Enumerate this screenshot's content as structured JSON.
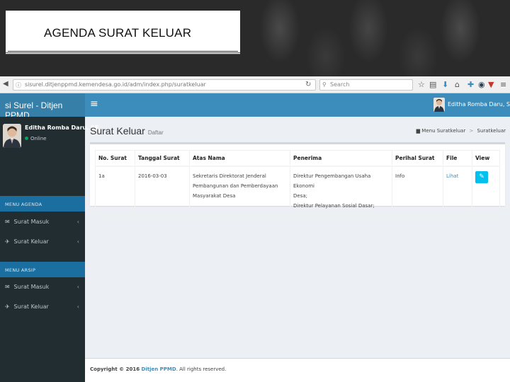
{
  "slide": {
    "title": "AGENDA SURAT KELUAR"
  },
  "browser": {
    "url": "sisurel.ditjenppmd.kemendesa.go.id/adm/index.php/suratkeluar",
    "search_placeholder": "Search"
  },
  "app": {
    "logo": "si Surel - Ditjen PPMD",
    "hamburger": "≡",
    "header_user_name": "Editha Romba Daru, SE"
  },
  "sidebar": {
    "user_name": "Editha Romba Daru, SE",
    "user_status": "Online",
    "sections": [
      {
        "header": "MENU AGENDA",
        "items": [
          {
            "label": "Surat Masuk",
            "icon": "envelope-icon"
          },
          {
            "label": "Surat Keluar",
            "icon": "paper-plane-icon"
          }
        ]
      },
      {
        "header": "MENU ARSIP",
        "items": [
          {
            "label": "Surat Masuk",
            "icon": "envelope-icon"
          },
          {
            "label": "Surat Keluar",
            "icon": "paper-plane-icon"
          }
        ]
      }
    ]
  },
  "content": {
    "title": "Surat Keluar",
    "subtitle": "Daftar",
    "breadcrumb": [
      "Menu Suratkeluar",
      "Suratkeluar"
    ]
  },
  "table": {
    "columns": [
      "No. Surat",
      "Tanggal Surat",
      "Atas Nama",
      "Penerima",
      "Perihal Surat",
      "File",
      "View"
    ],
    "rows": [
      {
        "no_surat": "1a",
        "tanggal": "2016-03-03",
        "atas_nama": [
          "Sekretaris Direktorat Jenderal",
          "Pembangunan dan Pemberdayaan",
          "Masyarakat Desa"
        ],
        "penerima": [
          "Direktur Pengembangan Usaha Ekonomi",
          "Desa;",
          "Direktur Pelayanan Sosial Dasar;"
        ],
        "perihal": "Info",
        "file": "Lihat",
        "view_icon": "edit-icon"
      }
    ]
  },
  "footer": {
    "prefix": "Copyright © 2016 ",
    "org": "Ditjen PPMD",
    "suffix": ". All rights reserved."
  },
  "colors": {
    "header_blue": "#3c8dbc",
    "sidebar_dark": "#222d32",
    "view_button": "#00c0ef"
  }
}
